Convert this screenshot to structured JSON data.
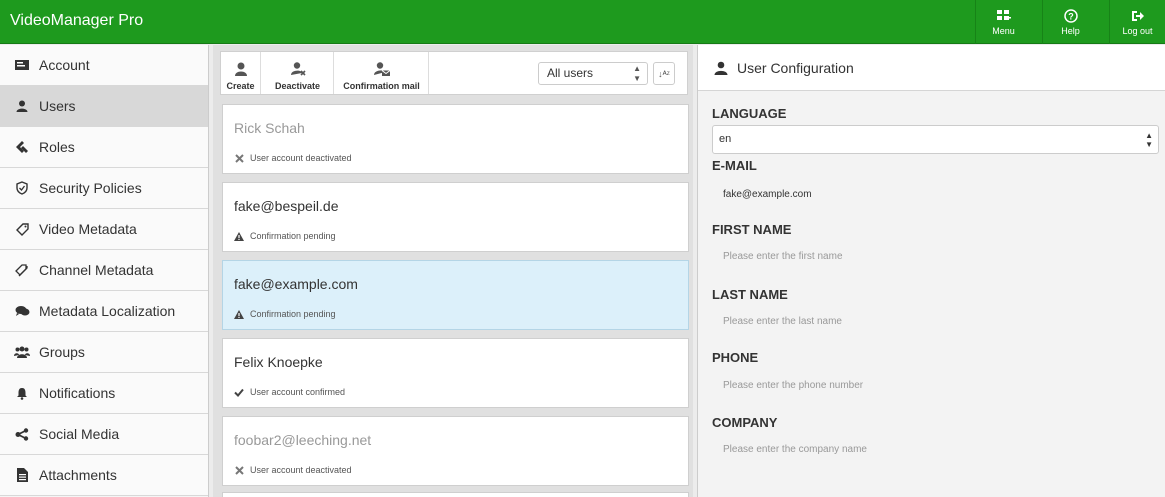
{
  "app": {
    "title": "VideoManager Pro"
  },
  "header_buttons": {
    "menu": "Menu",
    "help": "Help",
    "logout": "Log out"
  },
  "sidebar": {
    "items": [
      {
        "label": "Account",
        "icon": "account-icon"
      },
      {
        "label": "Users",
        "icon": "user-icon",
        "active": true
      },
      {
        "label": "Roles",
        "icon": "roles-icon"
      },
      {
        "label": "Security Policies",
        "icon": "shield-icon"
      },
      {
        "label": "Video Metadata",
        "icon": "tag-icon"
      },
      {
        "label": "Channel Metadata",
        "icon": "tags-icon"
      },
      {
        "label": "Metadata Localization",
        "icon": "chat-icon"
      },
      {
        "label": "Groups",
        "icon": "group-icon"
      },
      {
        "label": "Notifications",
        "icon": "bell-icon"
      },
      {
        "label": "Social Media",
        "icon": "share-icon"
      },
      {
        "label": "Attachments",
        "icon": "file-icon"
      }
    ]
  },
  "toolbar": {
    "create_label": "Create",
    "deactivate_label": "Deactivate",
    "confirmation_mail_label": "Confirmation mail",
    "filter_value": "All users"
  },
  "users": [
    {
      "name": "Rick Schah",
      "status": "User account deactivated",
      "status_icon": "x-icon"
    },
    {
      "name": "fake@bespeil.de",
      "status": "Confirmation pending",
      "status_icon": "warning-icon"
    },
    {
      "name": "fake@example.com",
      "status": "Confirmation pending",
      "status_icon": "warning-icon",
      "selected": true
    },
    {
      "name": "Felix Knoepke",
      "status": "User account confirmed",
      "status_icon": "check-icon"
    },
    {
      "name": "foobar2@leeching.net",
      "status": "User account deactivated",
      "status_icon": "x-icon"
    }
  ],
  "config": {
    "title": "User Configuration",
    "language_label": "LANGUAGE",
    "language_value": "en",
    "email_label": "E-MAIL",
    "email_value": "fake@example.com",
    "first_name_label": "FIRST NAME",
    "first_name_placeholder": "Please enter the first name",
    "last_name_label": "LAST NAME",
    "last_name_placeholder": "Please enter the last name",
    "phone_label": "PHONE",
    "phone_placeholder": "Please enter the phone number",
    "company_label": "COMPANY",
    "company_placeholder": "Please enter the company name"
  },
  "colors": {
    "header": "#1e9a1e",
    "selected_row": "#dcf0fa",
    "active_sidebar": "#d8d8d8"
  }
}
